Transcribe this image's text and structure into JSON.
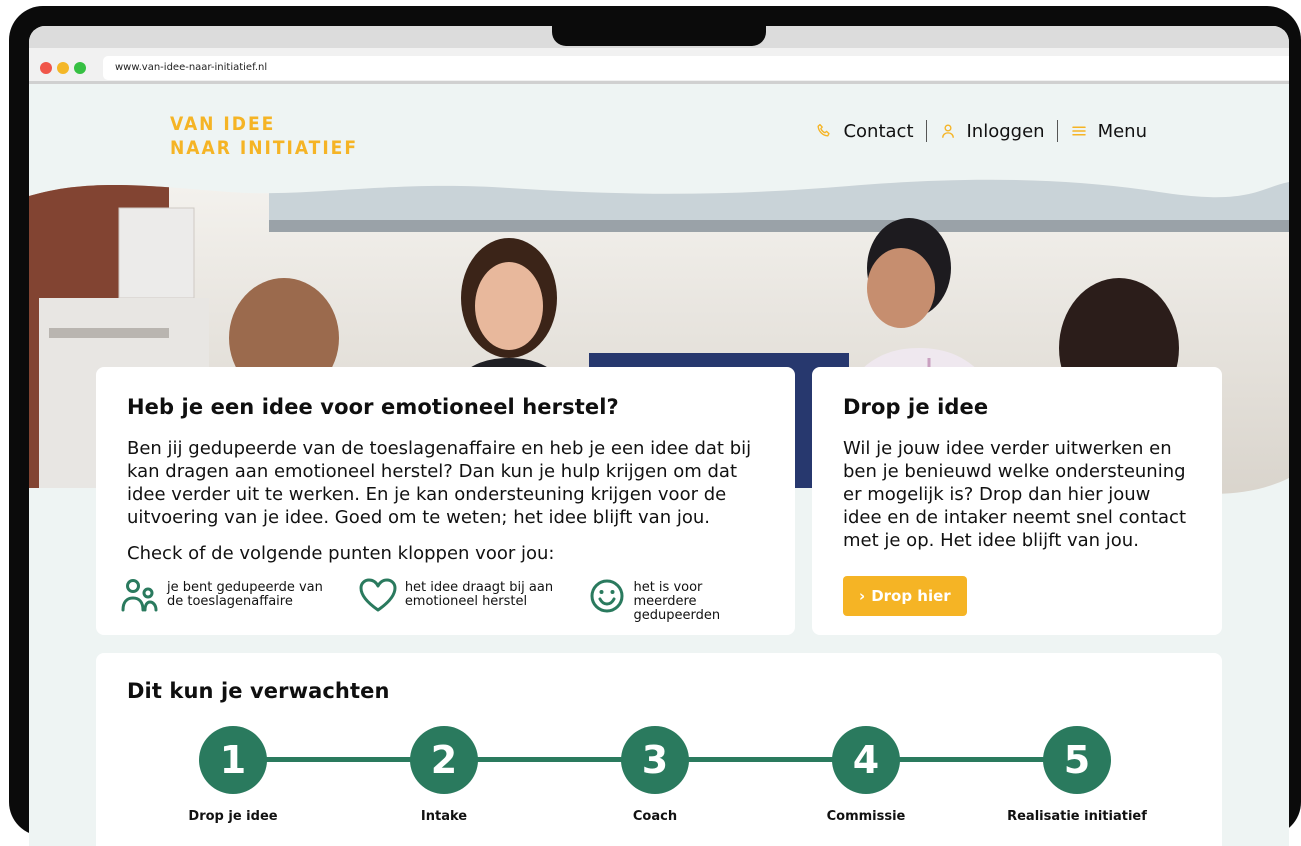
{
  "browser": {
    "url": "www.van-idee-naar-initiatief.nl"
  },
  "site": {
    "logo_line1": "VAN IDEE",
    "logo_line2": "NAAR INITIATIEF"
  },
  "nav": {
    "contact": "Contact",
    "login": "Inloggen",
    "menu": "Menu"
  },
  "intro": {
    "title": "Heb je een idee voor emotioneel herstel?",
    "body": "Ben jij gedupeerde van de toeslagenaffaire en heb je een idee dat bij kan dragen aan emotioneel herstel? Dan kun je hulp krijgen om dat idee verder uit te werken. En je kan ondersteuning krijgen voor de uitvoering van je idee. Goed om te weten; het idee blijft van jou.",
    "check": "Check of de volgende punten kloppen voor jou:",
    "criteria": [
      {
        "text": "je bent gedupeerde van de toeslagenaffaire",
        "icon": "people-icon"
      },
      {
        "text": "het idee draagt bij aan emotioneel herstel",
        "icon": "heart-icon"
      },
      {
        "text": "het is voor meerdere gedupeerden",
        "icon": "smiley-icon"
      }
    ]
  },
  "drop": {
    "title": "Drop je idee",
    "body": "Wil je jouw idee verder uitwerken en ben je benieuwd welke ondersteuning er mogelijk is? Drop dan hier jouw idee en de intaker neemt snel contact met je op. Het idee blijft van jou.",
    "button": "Drop hier"
  },
  "expect": {
    "title": "Dit kun je verwachten",
    "steps": [
      {
        "number": "1",
        "label": "Drop je idee"
      },
      {
        "number": "2",
        "label": "Intake"
      },
      {
        "number": "3",
        "label": "Coach"
      },
      {
        "number": "4",
        "label": "Commissie"
      },
      {
        "number": "5",
        "label": "Realisatie initiatief"
      }
    ]
  },
  "colors": {
    "brand_yellow": "#f5b425",
    "brand_green": "#2a7a5e",
    "page_bg": "#eef4f3"
  }
}
